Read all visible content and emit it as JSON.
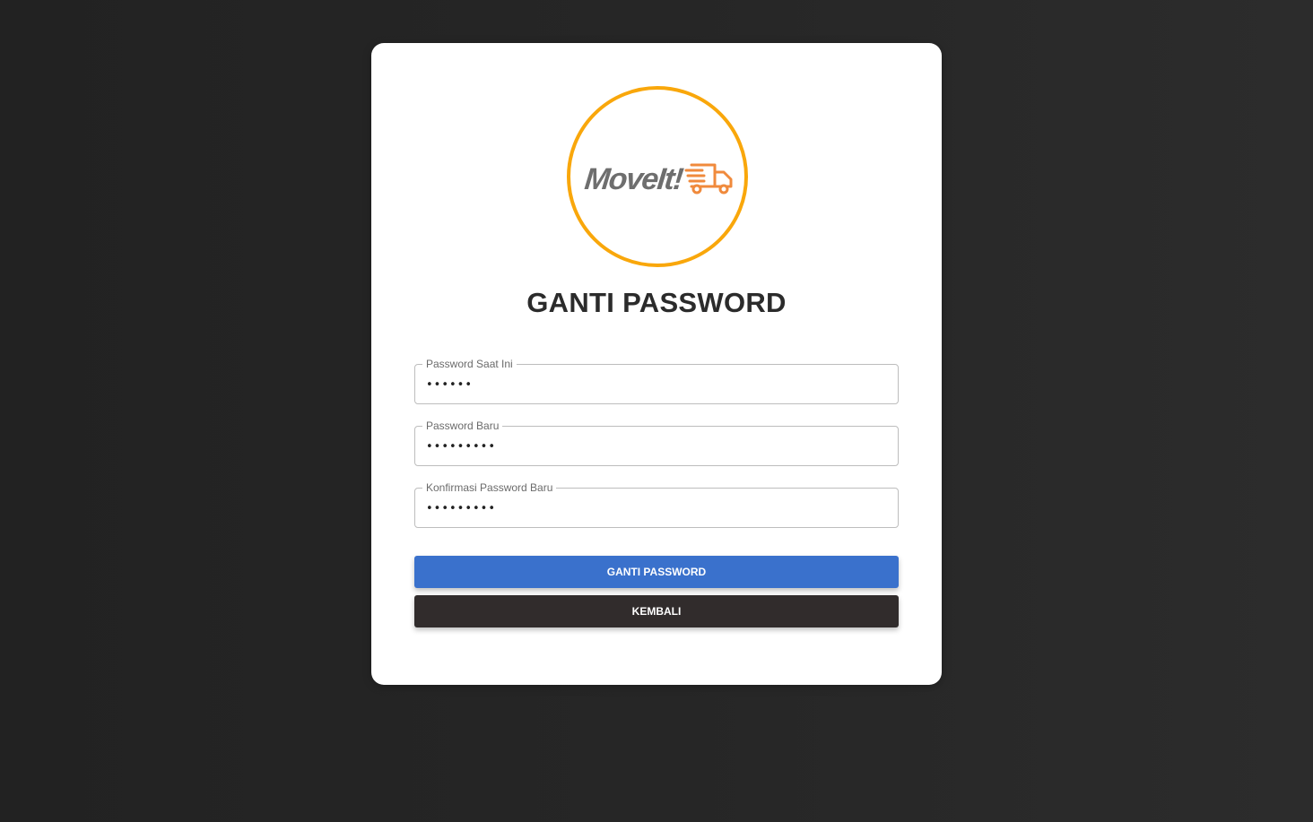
{
  "logo": {
    "text": "MoveIt!",
    "ring_color": "#f9a70b",
    "icon": "truck-icon",
    "icon_color": "#f08a3c"
  },
  "title": "GANTI PASSWORD",
  "form": {
    "current_password": {
      "label": "Password Saat Ini",
      "value": "••••••"
    },
    "new_password": {
      "label": "Password Baru",
      "value": "•••••••••"
    },
    "confirm_password": {
      "label": "Konfirmasi Password Baru",
      "value": "•••••••••"
    }
  },
  "buttons": {
    "submit_label": "GANTI PASSWORD",
    "back_label": "KEMBALI"
  },
  "colors": {
    "primary": "#3a71cc",
    "dark": "#312c2c",
    "background": "#262626"
  }
}
